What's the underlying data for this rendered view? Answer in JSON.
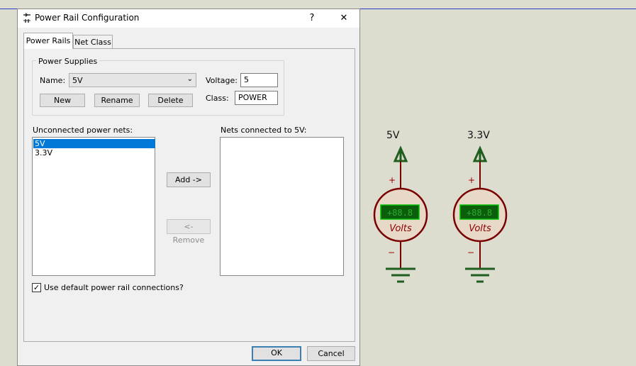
{
  "dialog": {
    "title": "Power Rail Configuration",
    "help_label": "?",
    "close_label": "✕",
    "tabs": [
      "Power Rails",
      "Net Class"
    ],
    "power_supplies_group": "Power Supplies",
    "name_label": "Name:",
    "name_value": "5V",
    "voltage_label": "Voltage:",
    "voltage_value": "5",
    "class_label": "Class:",
    "class_value": "POWER",
    "new_label": "New",
    "rename_label": "Rename",
    "delete_label": "Delete",
    "unconnected_label": "Unconnected power nets:",
    "unconnected_items": [
      "5V",
      "3.3V"
    ],
    "connected_label": "Nets connected to 5V:",
    "add_label": "Add ->",
    "remove_label": "<- Remove",
    "use_default_label": "Use default power rail connections?",
    "use_default_checked": true,
    "check_mark": "✓",
    "ok_label": "OK",
    "cancel_label": "Cancel"
  },
  "schematic": {
    "rail_labels": [
      "5V",
      "3.3V"
    ],
    "meter_display": "+88.8",
    "meter_unit": "Volts",
    "plus_sign": "+",
    "minus_sign": "−",
    "wire_color": "#7a0000",
    "arrow_color": "#1f5e1f",
    "meter_fill": "#e8d8c8",
    "display_fill": "#0b5e0b"
  }
}
